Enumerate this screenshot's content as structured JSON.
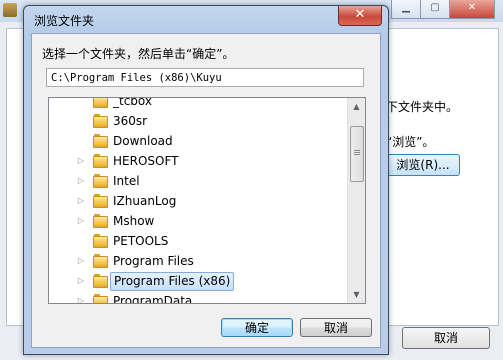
{
  "background_window": {
    "text_line1": "下文件夹中。",
    "text_line2": "“浏览”。",
    "browse_label": "浏览",
    "browse_accel": "(R)...",
    "cancel_label": "取消"
  },
  "dialog": {
    "title": "浏览文件夹",
    "close_glyph": "✕",
    "instruction": "选择一个文件夹，然后单击“确定”。",
    "path": "C:\\Program Files (x86)\\Kuyu",
    "tree_items": [
      {
        "label": "_tcbox",
        "expandable": false,
        "selected": false
      },
      {
        "label": "360sr",
        "expandable": false,
        "selected": false
      },
      {
        "label": "Download",
        "expandable": false,
        "selected": false
      },
      {
        "label": "HEROSOFT",
        "expandable": true,
        "selected": false
      },
      {
        "label": "Intel",
        "expandable": true,
        "selected": false
      },
      {
        "label": "IZhuanLog",
        "expandable": true,
        "selected": false
      },
      {
        "label": "Mshow",
        "expandable": true,
        "selected": false
      },
      {
        "label": "PETOOLS",
        "expandable": false,
        "selected": false
      },
      {
        "label": "Program Files",
        "expandable": true,
        "selected": false
      },
      {
        "label": "Program Files (x86)",
        "expandable": true,
        "selected": true
      },
      {
        "label": "ProgramData",
        "expandable": true,
        "selected": false
      }
    ],
    "ok_label": "确定",
    "cancel_label": "取消"
  },
  "icons": {
    "folder": "folder-icon",
    "expand": "chevron-right-icon",
    "scroll_up": "arrow-up-icon",
    "scroll_down": "arrow-down-icon"
  }
}
